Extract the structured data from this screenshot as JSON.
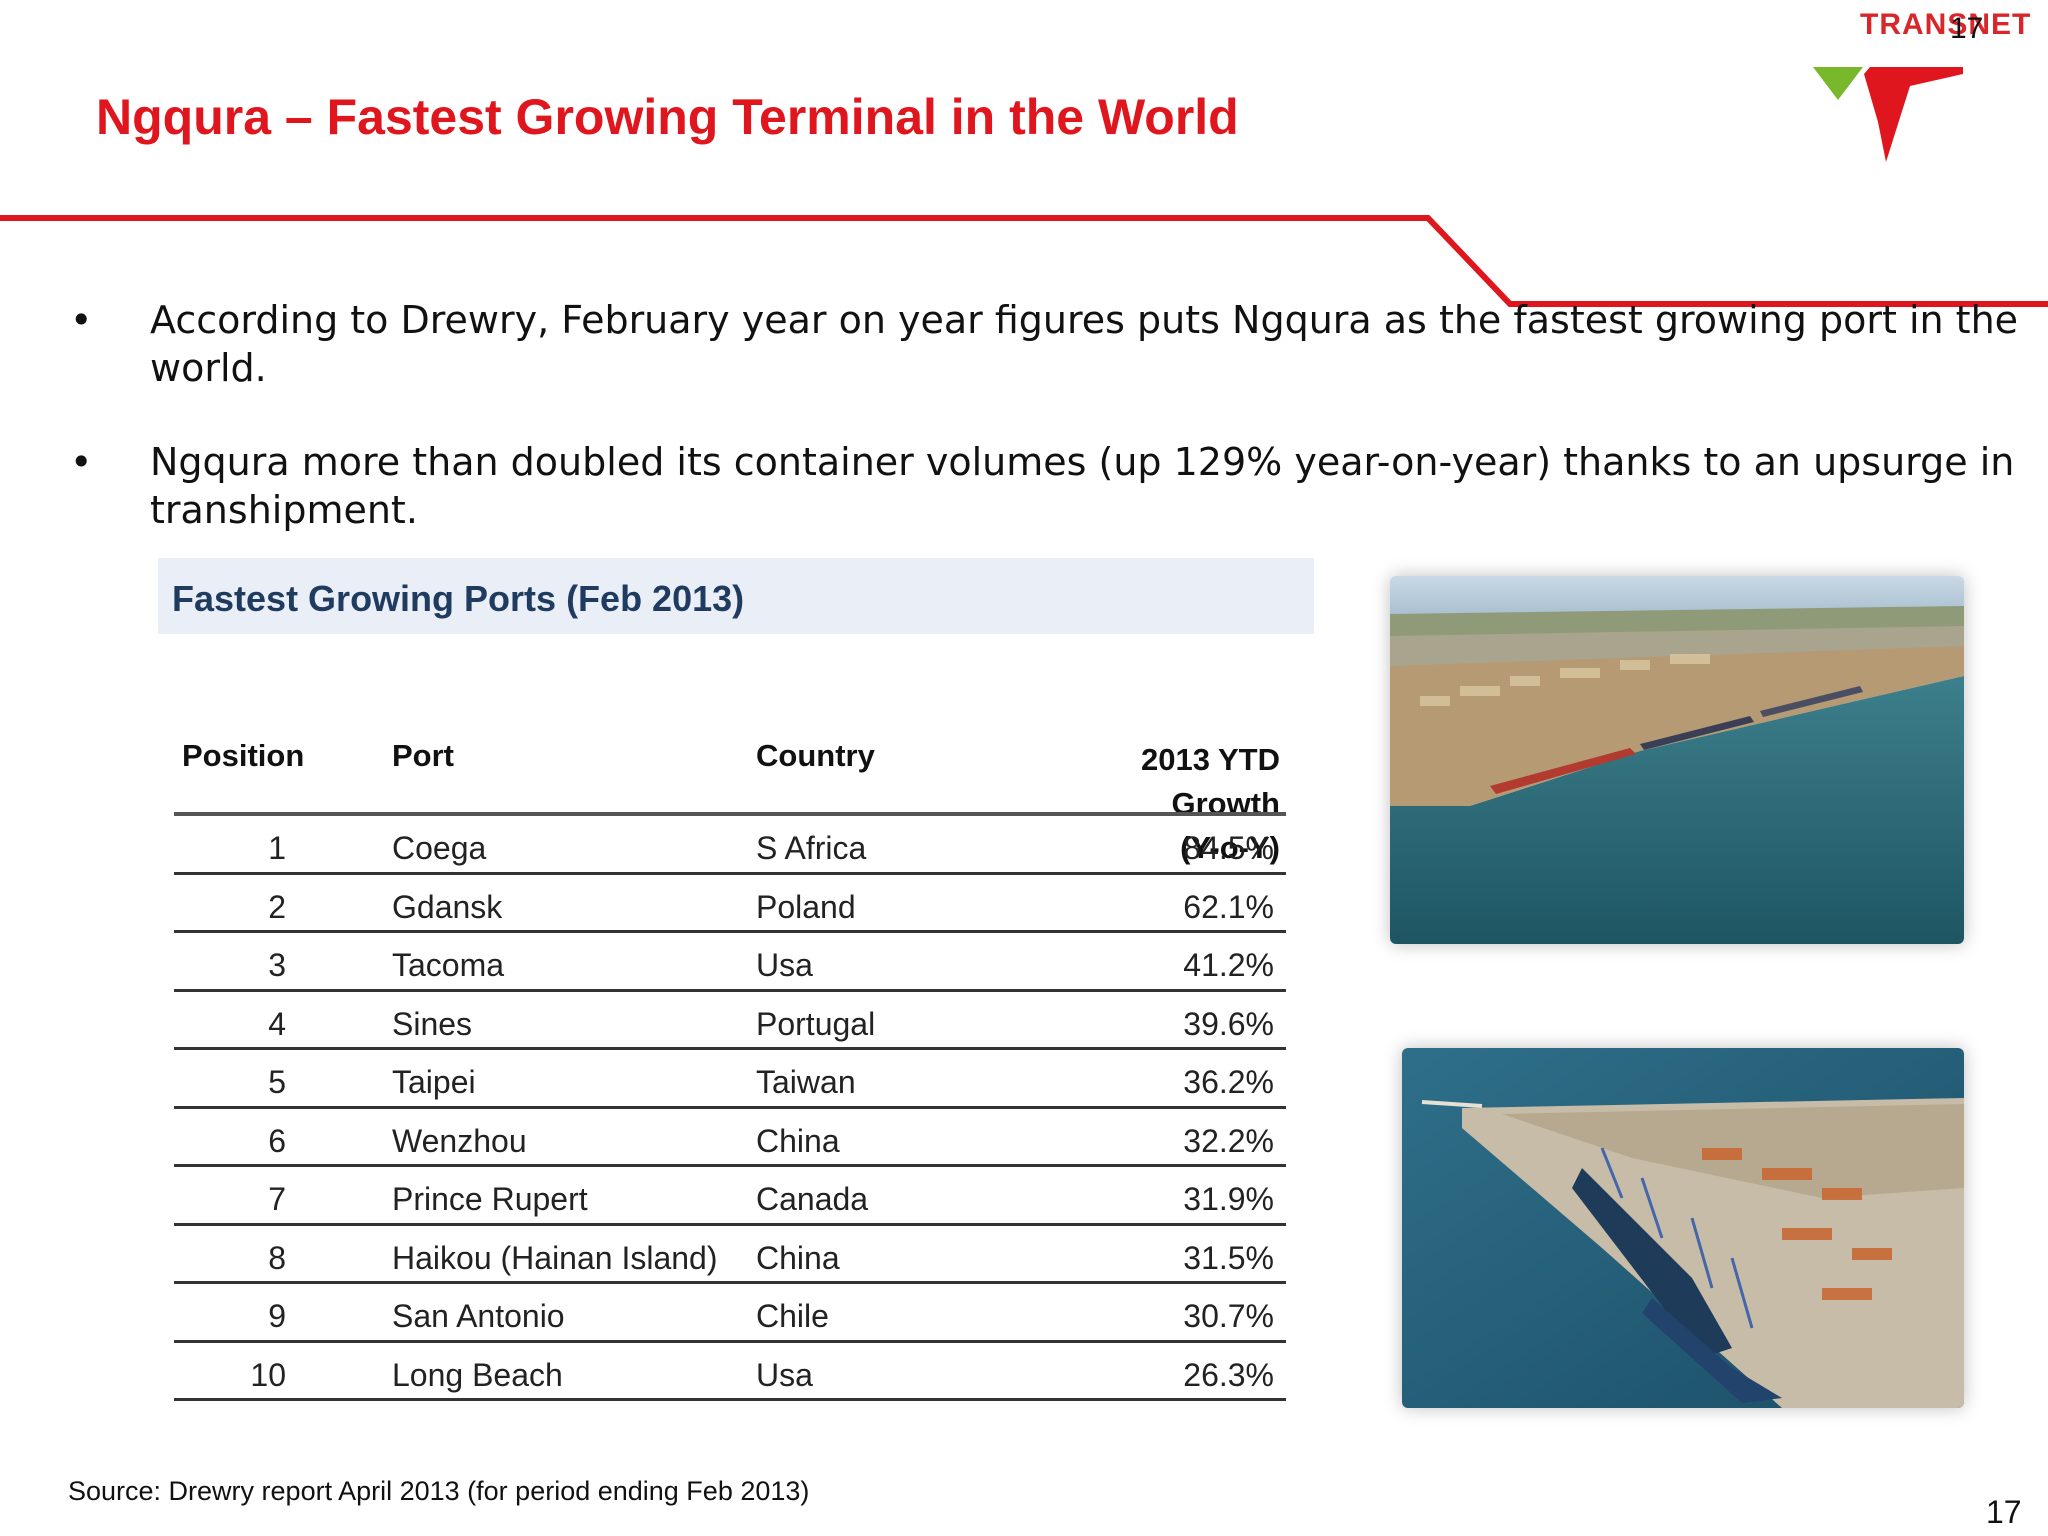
{
  "header": {
    "brand": "TRANSNET",
    "page_number_top": "17",
    "title": "Ngqura – Fastest Growing Terminal in the World",
    "colors": {
      "accent_red": "#e0161e",
      "logo_green": "#78b82a"
    }
  },
  "bullets": [
    "According to Drewry, February year on year figures puts Ngqura as the fastest growing port in the world.",
    "Ngqura more than doubled its container volumes (up 129% year-on-year) thanks to an upsurge in transhipment."
  ],
  "table": {
    "title": "Fastest Growing Ports (Feb 2013)",
    "columns": {
      "position": "Position",
      "port": "Port",
      "country": "Country",
      "growth_line1": "2013 YTD",
      "growth_line2": "Growth",
      "growth_line3": "(Y-o-Y)"
    },
    "rows": [
      {
        "position": "1",
        "port": "Coega",
        "country": "S Africa",
        "growth": "84.5%"
      },
      {
        "position": "2",
        "port": "Gdansk",
        "country": "Poland",
        "growth": "62.1%"
      },
      {
        "position": "3",
        "port": "Tacoma",
        "country": "Usa",
        "growth": "41.2%"
      },
      {
        "position": "4",
        "port": "Sines",
        "country": "Portugal",
        "growth": "39.6%"
      },
      {
        "position": "5",
        "port": "Taipei",
        "country": "Taiwan",
        "growth": "36.2%"
      },
      {
        "position": "6",
        "port": "Wenzhou",
        "country": "China",
        "growth": "32.2%"
      },
      {
        "position": "7",
        "port": "Prince Rupert",
        "country": "Canada",
        "growth": "31.9%"
      },
      {
        "position": "8",
        "port": "Haikou (Hainan Island)",
        "country": "China",
        "growth": "31.5%"
      },
      {
        "position": "9",
        "port": "San Antonio",
        "country": "Chile",
        "growth": "30.7%"
      },
      {
        "position": "10",
        "port": "Long Beach",
        "country": "Usa",
        "growth": "26.3%"
      }
    ]
  },
  "footer": {
    "source": "Source: Drewry report April 2013 (for period ending Feb 2013)",
    "page_number": "17"
  }
}
